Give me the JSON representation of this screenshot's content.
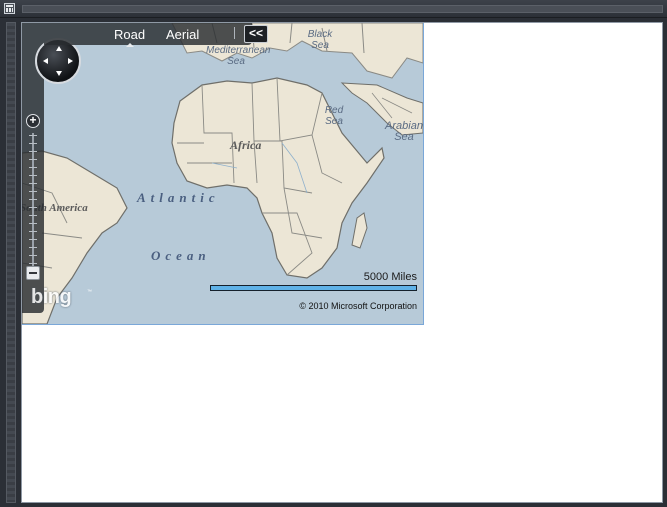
{
  "window": {
    "icon": "grid-icon"
  },
  "map": {
    "nav": {
      "tabs": [
        "Road",
        "Aerial"
      ],
      "active_tab": "Road",
      "collapse_label": "<<"
    },
    "controls": {
      "compass": "compass-pan-control",
      "zoom_in_label": "+",
      "zoom_out": "zoom-out"
    },
    "labels": {
      "mediterranean": "Mediterranean Sea",
      "black_sea": "Black Sea",
      "red_sea": "Red Sea",
      "arabian_sea": "Arabian Sea",
      "africa": "Africa",
      "atlantic": "Atlantic",
      "ocean": "Ocean",
      "south_america": "South America"
    },
    "logo": "bing",
    "logo_mark": "™",
    "scale_label": "5000 Miles",
    "copyright": "© 2010 Microsoft Corporation",
    "colors": {
      "water": "#b7cad8",
      "land": "#ece6d6",
      "scale_bar": "#5fb2e8",
      "border_accent": "#7aa7d8"
    }
  }
}
